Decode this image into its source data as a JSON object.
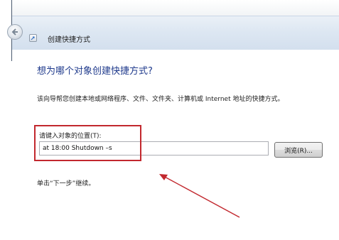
{
  "window": {
    "title": "创建快捷方式"
  },
  "page": {
    "heading": "想为哪个对象创建快捷方式?",
    "description": "该向导帮您创建本地或网络程序、文件、文件夹、计算机或 Internet 地址的快捷方式。",
    "location_label": "请键入对象的位置(T):",
    "location_value": "at 18:00 Shutdown –s",
    "browse_label": "浏览(R)...",
    "next_hint": "单击“下一步”继续。"
  },
  "icons": {
    "back": "back-arrow-icon",
    "wizard": "shortcut-wizard-icon"
  },
  "colors": {
    "heading": "#1f3a8c",
    "annotation": "#c2282e",
    "titlebar": "#dde7f2"
  }
}
